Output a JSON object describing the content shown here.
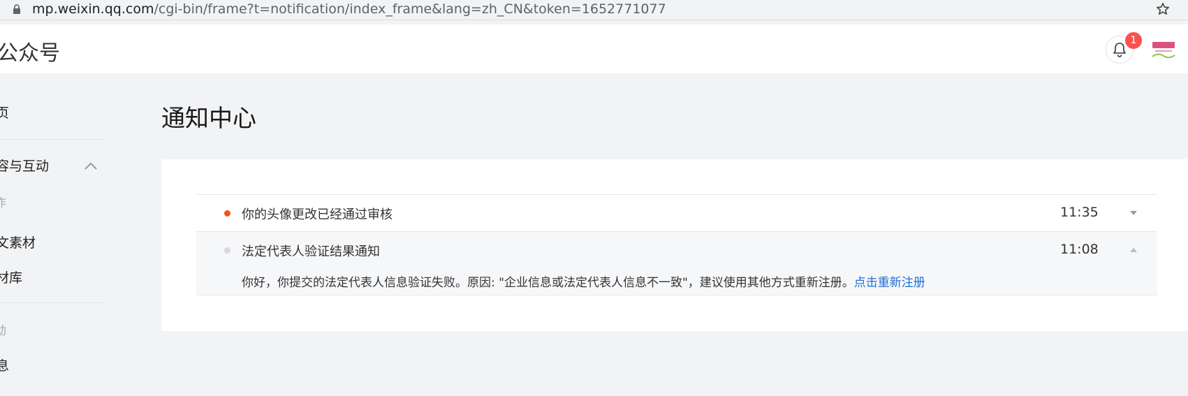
{
  "browser": {
    "url_domain": "mp.weixin.qq.com",
    "url_path": "/cgi-bin/frame?t=notification/index_frame&lang=zh_CN&token=1652771077"
  },
  "header": {
    "brand": "公众号",
    "notification_count": "1",
    "avatar_icon": "brand-logo"
  },
  "sidebar": {
    "items": [
      {
        "label": "页"
      },
      {
        "label": "容与互动"
      },
      {
        "label": "作"
      },
      {
        "label": "文素材"
      },
      {
        "label": "材库"
      },
      {
        "label": "动"
      },
      {
        "label": "息"
      }
    ]
  },
  "main": {
    "title": "通知中心",
    "notifications": [
      {
        "title": "你的头像更改已经通过审核",
        "time": "11:35",
        "unread": true,
        "expanded": false
      },
      {
        "title": "法定代表人验证结果通知",
        "time": "11:08",
        "unread": false,
        "expanded": true,
        "body": "你好，你提交的法定代表人信息验证失败。原因: \"企业信息或法定代表人信息不一致\"，建议使用其他方式重新注册。",
        "link": "点击重新注册"
      }
    ]
  },
  "colors": {
    "unread_dot": "#fa5119",
    "read_dot": "#d9d9d9",
    "link": "#1e6dd6",
    "badge": "#fa5151"
  }
}
